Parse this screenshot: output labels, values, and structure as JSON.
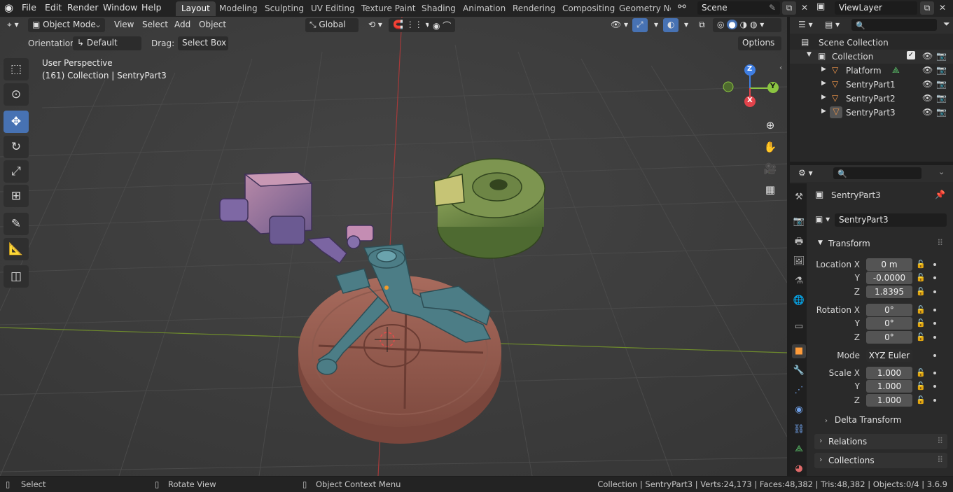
{
  "menu": {
    "file": "File",
    "edit": "Edit",
    "render": "Render",
    "window": "Window",
    "help": "Help"
  },
  "workspaces": [
    "Layout",
    "Modeling",
    "Sculpting",
    "UV Editing",
    "Texture Paint",
    "Shading",
    "Animation",
    "Rendering",
    "Compositing",
    "Geometry Noc"
  ],
  "scene": {
    "name": "Scene",
    "view_layer": "ViewLayer"
  },
  "viewport_header": {
    "mode": "Object Mode",
    "view": "View",
    "select": "Select",
    "add": "Add",
    "object": "Object",
    "transform_orientation": "Global",
    "orientation_label": "Orientation:",
    "orientation_value": "Default",
    "drag_label": "Drag:",
    "drag_value": "Select Box",
    "options": "Options"
  },
  "viewport": {
    "perspective": "User Perspective",
    "context": "(161) Collection | SentryPart3",
    "gizmo": {
      "z": "Z",
      "y": "Y",
      "x": "X"
    }
  },
  "toolbar_icons": [
    "select-box-icon",
    "cursor-icon",
    "move-icon",
    "rotate-icon",
    "scale-icon",
    "transform-icon",
    "annotate-icon",
    "measure-icon",
    "add-cube-icon"
  ],
  "outliner": {
    "search_placeholder": "",
    "root": "Scene Collection",
    "collection": "Collection",
    "items": [
      "Platform",
      "SentryPart1",
      "SentryPart2",
      "SentryPart3"
    ]
  },
  "properties": {
    "object_name": "SentryPart3",
    "datablock_name": "SentryPart3",
    "transform": {
      "title": "Transform",
      "location_label": "Location X",
      "location": [
        "0 m",
        "-0.0000",
        "1.8395"
      ],
      "rotation_label": "Rotation X",
      "rotation": [
        "0°",
        "0°",
        "0°"
      ],
      "mode_label": "Mode",
      "mode": "XYZ Euler",
      "scale_label": "Scale X",
      "scale": [
        "1.000",
        "1.000",
        "1.000"
      ],
      "y": "Y",
      "z": "Z"
    },
    "delta_transform": "Delta Transform",
    "relations": "Relations",
    "collections": "Collections"
  },
  "statusbar": {
    "select": "Select",
    "rotate": "Rotate View",
    "context_menu": "Object Context Menu",
    "stats": "Collection | SentryPart3 | Verts:24,173 | Faces:48,382 | Tris:48,382 | Objects:0/4 | 3.6.9"
  },
  "colors": {
    "accent": "#4772b3",
    "active_orange": "#ff9c3a",
    "x_axis": "#e2434b",
    "y_axis": "#8bc541",
    "z_axis": "#3f7ee2"
  }
}
